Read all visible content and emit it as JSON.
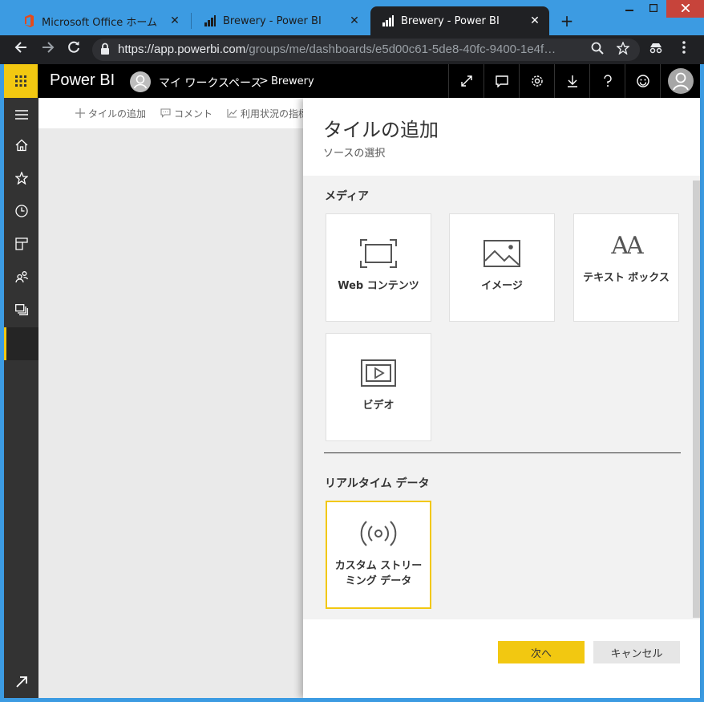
{
  "browser": {
    "tabs": [
      {
        "title": "Microsoft Office ホーム",
        "close": "✕"
      },
      {
        "title": "Brewery - Power BI",
        "close": "✕"
      },
      {
        "title": "Brewery - Power BI",
        "close": "✕"
      }
    ],
    "new_tab": "+",
    "url_host": "https://app.powerbi.com",
    "url_path": "/groups/me/dashboards/e5d00c61-5de8-40fc-9400-1e4f…"
  },
  "header": {
    "brand": "Power BI",
    "workspace": "マイ ワークスペース",
    "separator": ">",
    "dashboard": "Brewery"
  },
  "toolbar": {
    "add_tile": "タイルの追加",
    "comment": "コメント",
    "usage": "利用状況の指標"
  },
  "panel": {
    "title": "タイルの追加",
    "subtitle": "ソースの選択",
    "media_section": "メディア",
    "media_tiles": [
      {
        "label": "Web コンテンツ",
        "icon": "web-content-icon"
      },
      {
        "label": "イメージ",
        "icon": "image-icon"
      },
      {
        "label": "テキスト ボックス",
        "icon": "text-box-icon"
      },
      {
        "label": "ビデオ",
        "icon": "video-icon"
      }
    ],
    "text_icon_glyph": "AA",
    "realtime_section": "リアルタイム データ",
    "realtime_tiles": [
      {
        "label": "カスタム ストリーミング データ",
        "icon": "streaming-icon"
      }
    ],
    "next_label": "次へ",
    "cancel_label": "キャンセル"
  },
  "colors": {
    "accent": "#f2c811",
    "header_bg": "#000000",
    "nav_bg": "#333333",
    "window_frame": "#3c9be2"
  }
}
